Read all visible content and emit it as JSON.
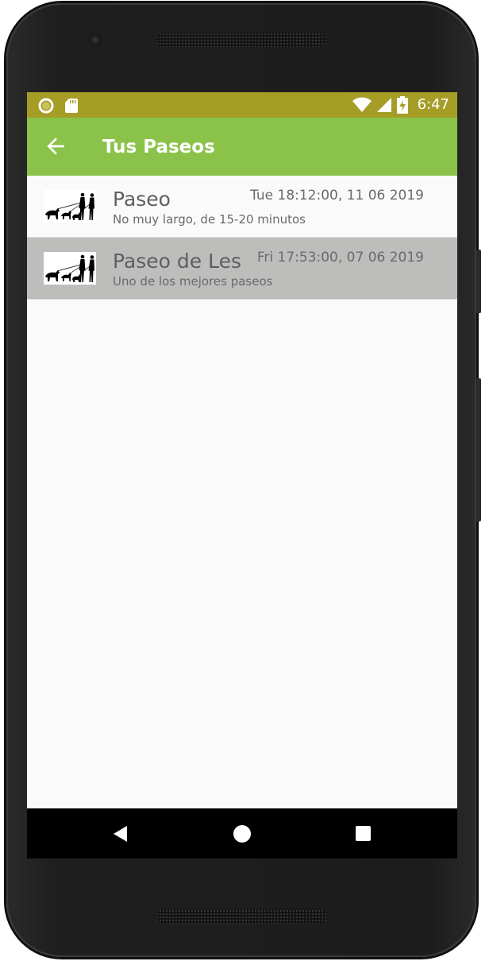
{
  "status_bar": {
    "time": "6:47",
    "left_icons": [
      "sync-circle-icon",
      "sd-card-icon"
    ],
    "right_icons": [
      "wifi-icon",
      "cell-signal-icon",
      "battery-charging-icon"
    ]
  },
  "app_bar": {
    "title": "Tus Paseos",
    "back_icon": "arrow-back-icon",
    "color": "#8bc34a"
  },
  "walks": [
    {
      "title": "Paseo",
      "date": "Tue 18:12:00, 11 06 2019",
      "description": "No muy largo, de 15-20 minutos",
      "thumbnail": "dog-walkers-silhouette",
      "selected": false
    },
    {
      "title": "Paseo de Les",
      "date": "Fri 17:53:00, 07 06 2019",
      "description": "Uno de los mejores paseos",
      "thumbnail": "dog-walkers-silhouette",
      "selected": true
    }
  ],
  "nav_bar": {
    "buttons": [
      "nav-back-icon",
      "nav-home-icon",
      "nav-recents-icon"
    ]
  },
  "colors": {
    "status_bar": "#a69d27",
    "app_bar": "#8bc34a",
    "selected_row": "#bdbdbc"
  }
}
